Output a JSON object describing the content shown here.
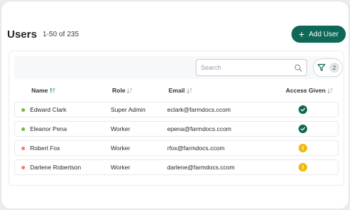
{
  "header": {
    "title": "Users",
    "count": "1-50 of 235",
    "add_label": "Add User"
  },
  "toolbar": {
    "search_placeholder": "Search",
    "filter_count": "2"
  },
  "columns": [
    "Name",
    "Role",
    "Email",
    "Access Given"
  ],
  "colors": {
    "accent": "#0e6757",
    "active_dot": "#7cb342",
    "inactive_dot": "#ef7b7b",
    "pending": "#f0b90b"
  },
  "rows": [
    {
      "name": "Edward Clark",
      "role": "Super Admin",
      "email": "eclark@farmdocs.ccom",
      "status": "granted"
    },
    {
      "name": "Eleanor Pena",
      "role": "Worker",
      "email": "epena@farmdocs.ccom",
      "status": "granted"
    },
    {
      "name": "Robert Fox",
      "role": "Worker",
      "email": "rfox@farmdocs.ccom",
      "status": "pending"
    },
    {
      "name": "Darlene Robertson",
      "role": "Worker",
      "email": "darlene@farmdocs.ccom",
      "status": "pending"
    }
  ]
}
